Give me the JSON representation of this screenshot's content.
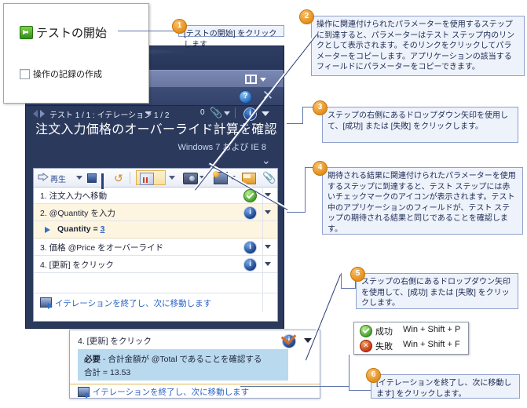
{
  "start_dialog": {
    "start_label": "テストの開始",
    "checkbox_label": "操作の記録の作成"
  },
  "runner": {
    "iteration_label": "テスト 1 / 1 : イテレーション 1 / 2",
    "attachment_count": "0",
    "info_badge": "i",
    "help_badge": "?",
    "close_label": "✕",
    "title": "注文入力価格のオーバーライド計算を確認",
    "configuration": "Windows 7 および IE 8",
    "toolbar": {
      "play_label": "再生"
    },
    "steps": [
      {
        "text": "1. 注文入力へ移動",
        "status": "pass",
        "status_glyph": ""
      },
      {
        "text": "2. @Quantity を入力",
        "status": "info",
        "status_glyph": "i"
      },
      {
        "param_name": "Quantity =",
        "param_value": "3"
      },
      {
        "text": "3. 価格 @Price をオーバーライド",
        "status": "info",
        "status_glyph": "i"
      },
      {
        "text": "4. [更新] をクリック",
        "status": "info",
        "status_glyph": "i"
      }
    ],
    "end_iteration_label": "イテレーションを終了し、次に移動します"
  },
  "detail_popup": {
    "step_text": "4. [更新] をクリック",
    "badge_glyph": "i",
    "expected_label": "必要",
    "expected_text": "- 合計金額が @Total であることを確認する",
    "expected_value": "合計 = 13.53",
    "end_iteration_label": "イテレーションを終了し、次に移動します"
  },
  "legend": {
    "rows": [
      {
        "icon": "pass-circle-icon",
        "label": "成功",
        "shortcut": "Win + Shift + P"
      },
      {
        "icon": "fail-circle-icon",
        "label": "失敗",
        "shortcut": "Win + Shift + F"
      }
    ]
  },
  "callouts": [
    {
      "number": "1",
      "text": "[テストの開始] をクリックします"
    },
    {
      "number": "2",
      "text": "操作に関連付けられたパラメーターを使用するステップに到達すると、パラメーターはテスト ステップ内のリンクとして表示されます。そのリンクをクリックしてパラメーターをコピーします。アプリケーションの該当するフィールドにパラメーターをコピーできます。"
    },
    {
      "number": "3",
      "text": "ステップの右側にあるドロップダウン矢印を使用して、[成功] または [失敗] をクリックします。"
    },
    {
      "number": "4",
      "text": "期待される結果に関連付けられたパラメーターを使用するステップに到達すると、テスト ステップには赤いチェックマークのアイコンが表示されます。テスト中のアプリケーションのフィールドが、テスト ステップの期待される結果と同じであることを確認します。"
    },
    {
      "number": "5",
      "text": "ステップの右側にあるドロップダウン矢印を使用して、[成功] または [失敗] をクリックします。"
    },
    {
      "number": "6",
      "text": "[イテレーションを終了し、次に移動します] をクリックします。"
    }
  ],
  "colors": {
    "callout_number": "#e08a14",
    "callout_bg": "#eef2fb",
    "window_bg": "#2b3a5c",
    "accent_link": "#2b62c4",
    "pass_green": "#3f9a27",
    "fail_red": "#c32d12",
    "highlight_row": "#fdf5e0",
    "expected_band": "#b9d9ef"
  }
}
